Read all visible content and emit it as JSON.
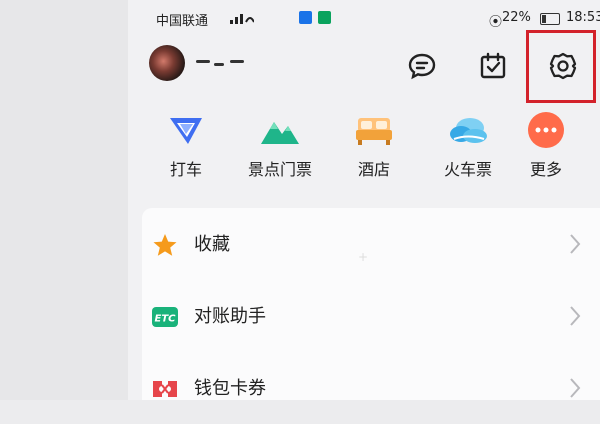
{
  "status_bar": {
    "carrier": "中国联通",
    "battery_pct": "22%",
    "time": "18:53"
  },
  "header": {
    "username": ""
  },
  "quick_actions": [
    {
      "label": "打车",
      "icon": "taxi-icon",
      "color": "#3f6ef1"
    },
    {
      "label": "景点门票",
      "icon": "scenic-ticket-icon",
      "color": "#1fb58a"
    },
    {
      "label": "酒店",
      "icon": "hotel-bed-icon",
      "color": "#f2a23a"
    },
    {
      "label": "火车票",
      "icon": "train-ticket-icon",
      "color": "#37a9e6"
    },
    {
      "label": "更多",
      "icon": "more-icon",
      "color": "#ff6b4a"
    }
  ],
  "menu": [
    {
      "label": "收藏",
      "icon": "star-icon",
      "color": "#f59a1b"
    },
    {
      "label": "对账助手",
      "icon": "etc-icon",
      "color": "#19b27a"
    },
    {
      "label": "钱包卡券",
      "icon": "wallet-coupon-icon",
      "color": "#e6454b"
    }
  ],
  "colors": {
    "highlight": "#d3222b",
    "page_bg": "#f1f1f3",
    "card_bg": "#fbfbfc"
  }
}
